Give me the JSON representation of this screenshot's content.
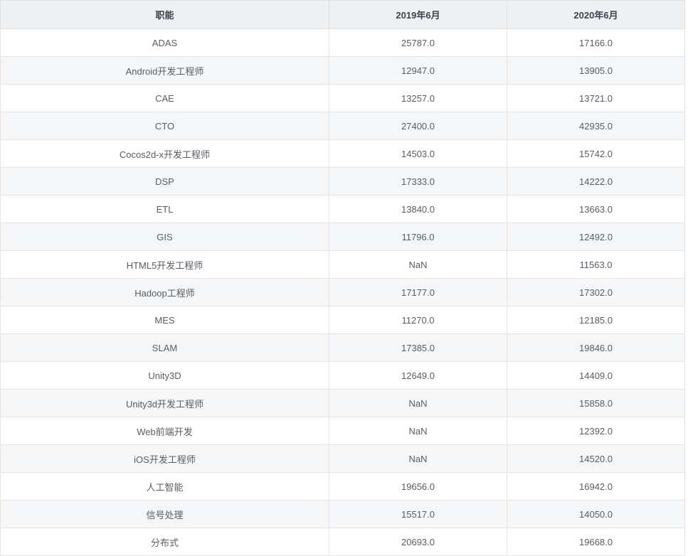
{
  "colors": {
    "header_background": "#eef1f4",
    "stripe_background": "#f5f6f7",
    "row_background": "#ffffff",
    "border": "#e2e2e2",
    "header_text": "#3d434b",
    "cell_text": "#585d63"
  },
  "chart_data": {
    "type": "table",
    "columns": [
      "职能",
      "2019年6月",
      "2020年6月"
    ],
    "rows": [
      [
        "ADAS",
        "25787.0",
        "17166.0"
      ],
      [
        "Android开发工程师",
        "12947.0",
        "13905.0"
      ],
      [
        "CAE",
        "13257.0",
        "13721.0"
      ],
      [
        "CTO",
        "27400.0",
        "42935.0"
      ],
      [
        "Cocos2d-x开发工程师",
        "14503.0",
        "15742.0"
      ],
      [
        "DSP",
        "17333.0",
        "14222.0"
      ],
      [
        "ETL",
        "13840.0",
        "13663.0"
      ],
      [
        "GIS",
        "11796.0",
        "12492.0"
      ],
      [
        "HTML5开发工程师",
        "NaN",
        "11563.0"
      ],
      [
        "Hadoop工程师",
        "17177.0",
        "17302.0"
      ],
      [
        "MES",
        "11270.0",
        "12185.0"
      ],
      [
        "SLAM",
        "17385.0",
        "19846.0"
      ],
      [
        "Unity3D",
        "12649.0",
        "14409.0"
      ],
      [
        "Unity3d开发工程师",
        "NaN",
        "15858.0"
      ],
      [
        "Web前端开发",
        "NaN",
        "12392.0"
      ],
      [
        "iOS开发工程师",
        "NaN",
        "14520.0"
      ],
      [
        "人工智能",
        "19656.0",
        "16942.0"
      ],
      [
        "信号处理",
        "15517.0",
        "14050.0"
      ],
      [
        "分布式",
        "20693.0",
        "19668.0"
      ]
    ]
  }
}
